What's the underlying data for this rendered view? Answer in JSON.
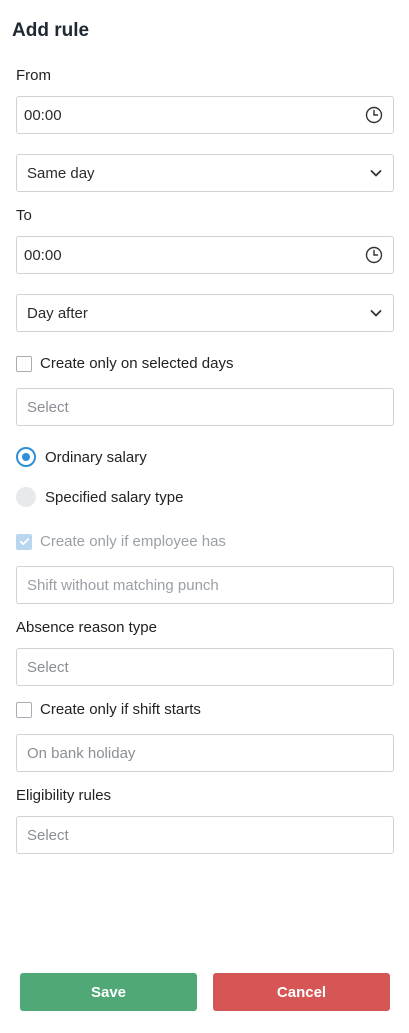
{
  "title": "Add rule",
  "from": {
    "label": "From",
    "time_value": "00:00",
    "day_select": "Same day"
  },
  "to": {
    "label": "To",
    "time_value": "00:00",
    "day_select": "Day after"
  },
  "selected_days": {
    "checkbox_label": "Create only on selected days",
    "checked": false,
    "placeholder": "Select"
  },
  "salary": {
    "options": [
      {
        "label": "Ordinary salary",
        "selected": true
      },
      {
        "label": "Specified salary type",
        "selected": false
      }
    ]
  },
  "employee_has": {
    "checkbox_label": "Create only if employee has",
    "checked": true,
    "disabled": true,
    "placeholder": "Shift without matching punch"
  },
  "absence_reason": {
    "label": "Absence reason type",
    "placeholder": "Select"
  },
  "shift_starts": {
    "checkbox_label": "Create only if shift starts",
    "checked": false,
    "placeholder": "On bank holiday"
  },
  "eligibility": {
    "label": "Eligibility rules",
    "placeholder": "Select"
  },
  "buttons": {
    "save": "Save",
    "cancel": "Cancel"
  },
  "colors": {
    "accent": "#2f8fd8",
    "save": "#4fa876",
    "cancel": "#d65655"
  },
  "icons": {
    "time": "clock-icon",
    "select": "chevron-down-icon"
  }
}
